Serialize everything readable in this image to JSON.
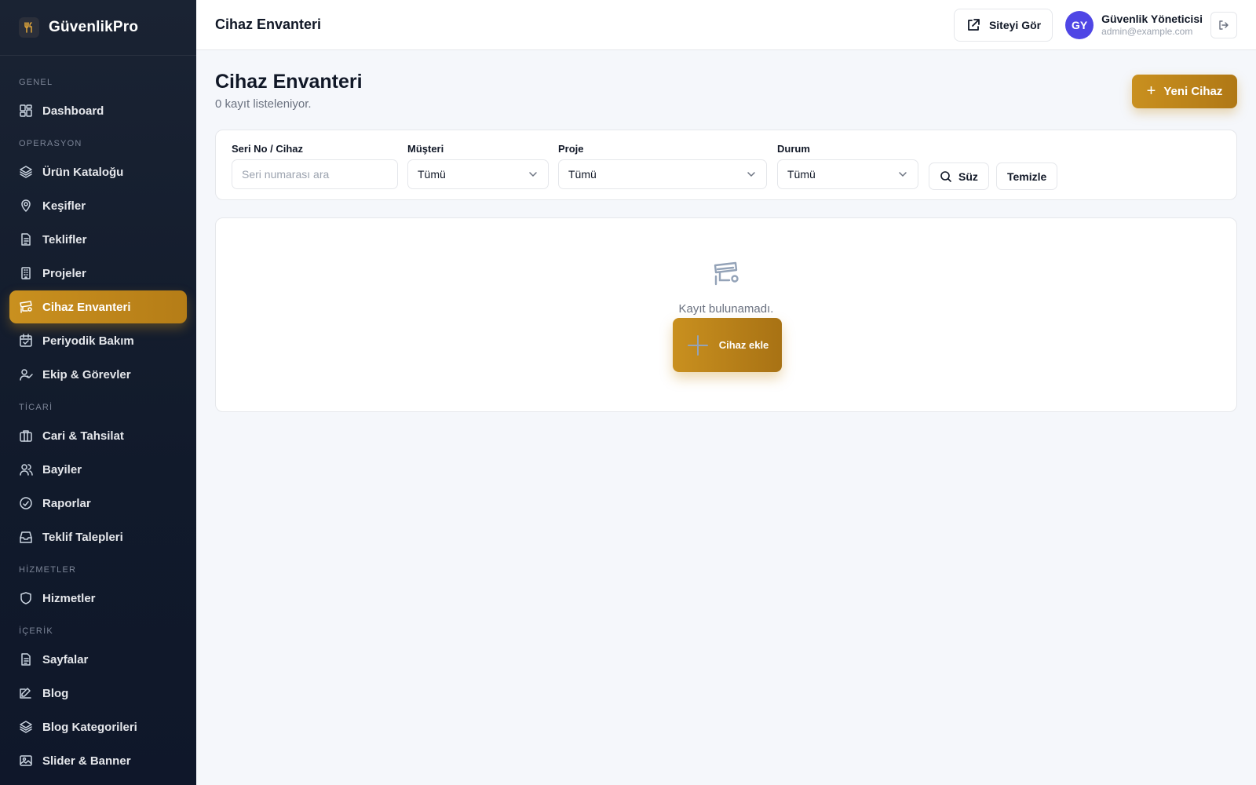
{
  "brand": {
    "name": "GüvenlikPro"
  },
  "sidebar": {
    "sections": [
      {
        "label": "GENEL",
        "items": [
          {
            "label": "Dashboard",
            "icon": "dashboard-icon"
          }
        ]
      },
      {
        "label": "OPERASYON",
        "items": [
          {
            "label": "Ürün Kataloğu",
            "icon": "layers-icon"
          },
          {
            "label": "Keşifler",
            "icon": "map-pin-icon"
          },
          {
            "label": "Teklifler",
            "icon": "document-icon"
          },
          {
            "label": "Projeler",
            "icon": "building-icon"
          },
          {
            "label": "Cihaz Envanteri",
            "icon": "cctv-icon",
            "active": true
          },
          {
            "label": "Periyodik Bakım",
            "icon": "calendar-check-icon"
          },
          {
            "label": "Ekip & Görevler",
            "icon": "user-check-icon"
          }
        ]
      },
      {
        "label": "TİCARİ",
        "items": [
          {
            "label": "Cari & Tahsilat",
            "icon": "briefcase-icon"
          },
          {
            "label": "Bayiler",
            "icon": "users-icon"
          },
          {
            "label": "Raporlar",
            "icon": "gauge-icon"
          },
          {
            "label": "Teklif Talepleri",
            "icon": "inbox-icon"
          }
        ]
      },
      {
        "label": "HİZMETLER",
        "items": [
          {
            "label": "Hizmetler",
            "icon": "shield-icon"
          }
        ]
      },
      {
        "label": "İÇERİK",
        "items": [
          {
            "label": "Sayfalar",
            "icon": "document-icon"
          },
          {
            "label": "Blog",
            "icon": "edit-icon"
          },
          {
            "label": "Blog Kategorileri",
            "icon": "layers-icon"
          },
          {
            "label": "Slider & Banner",
            "icon": "image-icon"
          }
        ]
      }
    ]
  },
  "topbar": {
    "title": "Cihaz Envanteri",
    "site_button": "Siteyi Gör",
    "user": {
      "initials": "GY",
      "name": "Güvenlik Yöneticisi",
      "email": "admin@example.com"
    }
  },
  "page": {
    "title": "Cihaz Envanteri",
    "subtitle": "0 kayıt listeleniyor.",
    "new_button": "Yeni Cihaz"
  },
  "filters": {
    "serial": {
      "label": "Seri No / Cihaz",
      "placeholder": "Seri numarası ara"
    },
    "customer": {
      "label": "Müşteri",
      "value": "Tümü"
    },
    "project": {
      "label": "Proje",
      "value": "Tümü"
    },
    "status": {
      "label": "Durum",
      "value": "Tümü"
    },
    "filter_button": "Süz",
    "clear_button": "Temizle"
  },
  "empty": {
    "text": "Kayıt bulunamadı.",
    "add_button": "Cihaz ekle"
  },
  "colors": {
    "accent": "#c9901f",
    "sidebar": "#111a2b",
    "avatar": "#4f46e5"
  }
}
